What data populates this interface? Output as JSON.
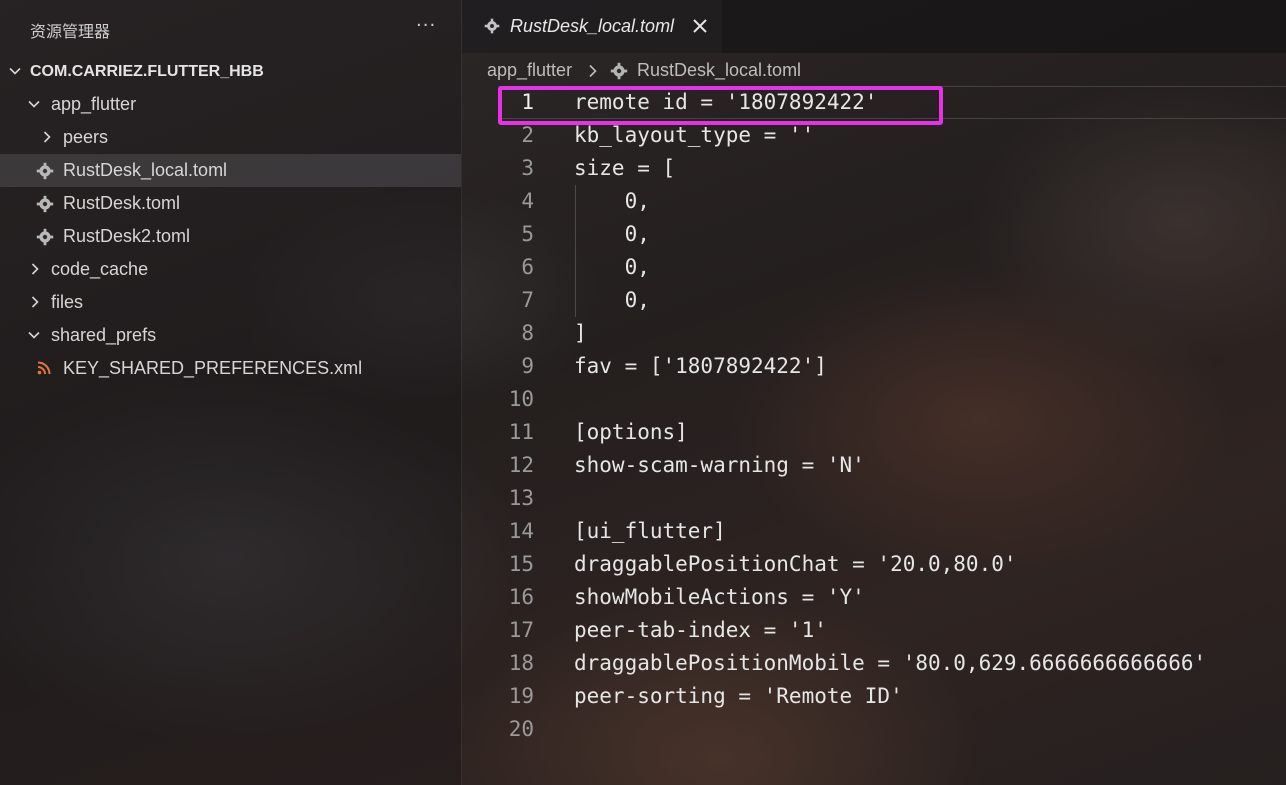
{
  "sidebar": {
    "title": "资源管理器",
    "more_icon": "ellipsis-icon",
    "tree": [
      {
        "label": "COM.CARRIEZ.FLUTTER_HBB",
        "kind": "root-folder",
        "expanded": true
      },
      {
        "label": "app_flutter",
        "kind": "folder",
        "expanded": true
      },
      {
        "label": "peers",
        "kind": "folder",
        "expanded": false
      },
      {
        "label": "RustDesk_local.toml",
        "kind": "file",
        "icon": "gear-icon",
        "selected": true
      },
      {
        "label": "RustDesk.toml",
        "kind": "file",
        "icon": "gear-icon"
      },
      {
        "label": "RustDesk2.toml",
        "kind": "file",
        "icon": "gear-icon"
      },
      {
        "label": "code_cache",
        "kind": "folder",
        "expanded": false
      },
      {
        "label": "files",
        "kind": "folder",
        "expanded": false
      },
      {
        "label": "shared_prefs",
        "kind": "folder",
        "expanded": true
      },
      {
        "label": "KEY_SHARED_PREFERENCES.xml",
        "kind": "file",
        "icon": "rss-icon"
      }
    ]
  },
  "editor": {
    "tab": {
      "label": "RustDesk_local.toml",
      "icon": "gear-icon",
      "close_icon": "close-icon"
    },
    "breadcrumb": {
      "folder": "app_flutter",
      "separator": ">",
      "file": "RustDesk_local.toml"
    },
    "lines": [
      {
        "n": "1",
        "text": "remote id = '1807892422'"
      },
      {
        "n": "2",
        "text": "kb_layout_type = ''"
      },
      {
        "n": "3",
        "text": "size = ["
      },
      {
        "n": "4",
        "text": "    0,"
      },
      {
        "n": "5",
        "text": "    0,"
      },
      {
        "n": "6",
        "text": "    0,"
      },
      {
        "n": "7",
        "text": "    0,"
      },
      {
        "n": "8",
        "text": "]"
      },
      {
        "n": "9",
        "text": "fav = ['1807892422']"
      },
      {
        "n": "10",
        "text": ""
      },
      {
        "n": "11",
        "text": "[options]"
      },
      {
        "n": "12",
        "text": "show-scam-warning = 'N'"
      },
      {
        "n": "13",
        "text": ""
      },
      {
        "n": "14",
        "text": "[ui_flutter]"
      },
      {
        "n": "15",
        "text": "draggablePositionChat = '20.0,80.0'"
      },
      {
        "n": "16",
        "text": "showMobileActions = 'Y'"
      },
      {
        "n": "17",
        "text": "peer-tab-index = '1'"
      },
      {
        "n": "18",
        "text": "draggablePositionMobile = '80.0,629.6666666666666'"
      },
      {
        "n": "19",
        "text": "peer-sorting = 'Remote ID'"
      },
      {
        "n": "20",
        "text": ""
      }
    ],
    "active_line": "1",
    "highlight_color": "#e632e6"
  }
}
